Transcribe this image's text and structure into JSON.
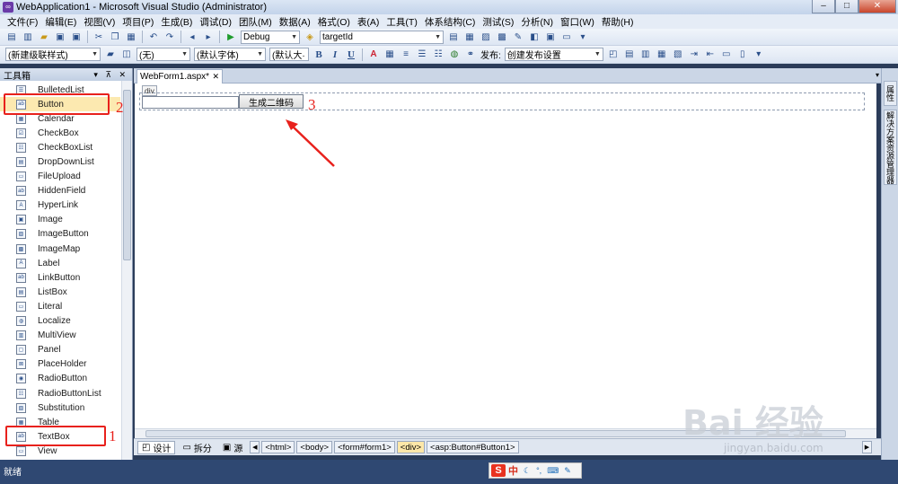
{
  "window": {
    "title": "WebApplication1 - Microsoft Visual Studio (Administrator)",
    "controls": [
      "–",
      "□",
      "✕"
    ]
  },
  "menu": [
    "文件(F)",
    "编辑(E)",
    "视图(V)",
    "项目(P)",
    "生成(B)",
    "调试(D)",
    "团队(M)",
    "数据(A)",
    "格式(O)",
    "表(A)",
    "工具(T)",
    "体系结构(C)",
    "测试(S)",
    "分析(N)",
    "窗口(W)",
    "帮助(H)"
  ],
  "toolbar1": {
    "config": "Debug",
    "find": "targetId"
  },
  "toolbar2": {
    "style": "(新建级联样式)",
    "block": "(无)",
    "font": "(默认字体)",
    "size": "(默认大·",
    "bold": "B",
    "italic": "I",
    "underline": "U",
    "publish_label": "发布:",
    "publish_setting": "创建发布设置"
  },
  "toolbox": {
    "title": "工具箱",
    "pins": "▾ ⊼ ✕",
    "items": [
      {
        "label": "BulletedList",
        "icon": "list-icon"
      },
      {
        "label": "Button",
        "icon": "button-icon"
      },
      {
        "label": "Calendar",
        "icon": "calendar-icon"
      },
      {
        "label": "CheckBox",
        "icon": "checkbox-icon"
      },
      {
        "label": "CheckBoxList",
        "icon": "checkbox-list-icon"
      },
      {
        "label": "DropDownList",
        "icon": "dropdown-icon"
      },
      {
        "label": "FileUpload",
        "icon": "file-upload-icon"
      },
      {
        "label": "HiddenField",
        "icon": "hidden-field-icon"
      },
      {
        "label": "HyperLink",
        "icon": "hyperlink-icon"
      },
      {
        "label": "Image",
        "icon": "image-icon"
      },
      {
        "label": "ImageButton",
        "icon": "image-button-icon"
      },
      {
        "label": "ImageMap",
        "icon": "image-map-icon"
      },
      {
        "label": "Label",
        "icon": "label-icon"
      },
      {
        "label": "LinkButton",
        "icon": "link-button-icon"
      },
      {
        "label": "ListBox",
        "icon": "listbox-icon"
      },
      {
        "label": "Literal",
        "icon": "literal-icon"
      },
      {
        "label": "Localize",
        "icon": "localize-icon"
      },
      {
        "label": "MultiView",
        "icon": "multiview-icon"
      },
      {
        "label": "Panel",
        "icon": "panel-icon"
      },
      {
        "label": "PlaceHolder",
        "icon": "placeholder-icon"
      },
      {
        "label": "RadioButton",
        "icon": "radio-icon"
      },
      {
        "label": "RadioButtonList",
        "icon": "radio-list-icon"
      },
      {
        "label": "Substitution",
        "icon": "substitution-icon"
      },
      {
        "label": "Table",
        "icon": "table-icon"
      },
      {
        "label": "TextBox",
        "icon": "textbox-icon"
      },
      {
        "label": "View",
        "icon": "view-icon"
      }
    ]
  },
  "editor": {
    "tab_label": "WebForm1.aspx*",
    "tab_close": "✕",
    "div_tag": "div",
    "button_text": "生成二维码"
  },
  "annotations": {
    "n1": "1",
    "n2": "2",
    "n3": "3",
    "color": "#e8211c"
  },
  "viewbar": {
    "design": "设计",
    "split": "拆分",
    "source": "源",
    "crumbs": [
      "<html>",
      "<body>",
      "<form#form1>",
      "<div>",
      "<asp:Button#Button1>"
    ]
  },
  "right_rail": [
    "属性",
    "解决方案资源管理器"
  ],
  "status": {
    "text": "就绪",
    "ime": "中"
  },
  "watermark": {
    "main": "Bai 经验",
    "url": "jingyan.baidu.com"
  }
}
